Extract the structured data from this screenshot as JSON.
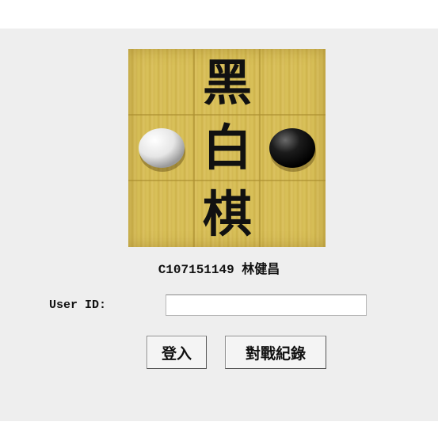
{
  "logo": {
    "characters": [
      "黑",
      "白",
      "棋"
    ],
    "stones": [
      "white-stone",
      "black-stone"
    ]
  },
  "owner_label": "C107151149 林健昌",
  "login_form": {
    "user_id_label": "User ID:",
    "user_id_value": "",
    "login_button": "登入",
    "records_button": "對戰紀錄"
  }
}
